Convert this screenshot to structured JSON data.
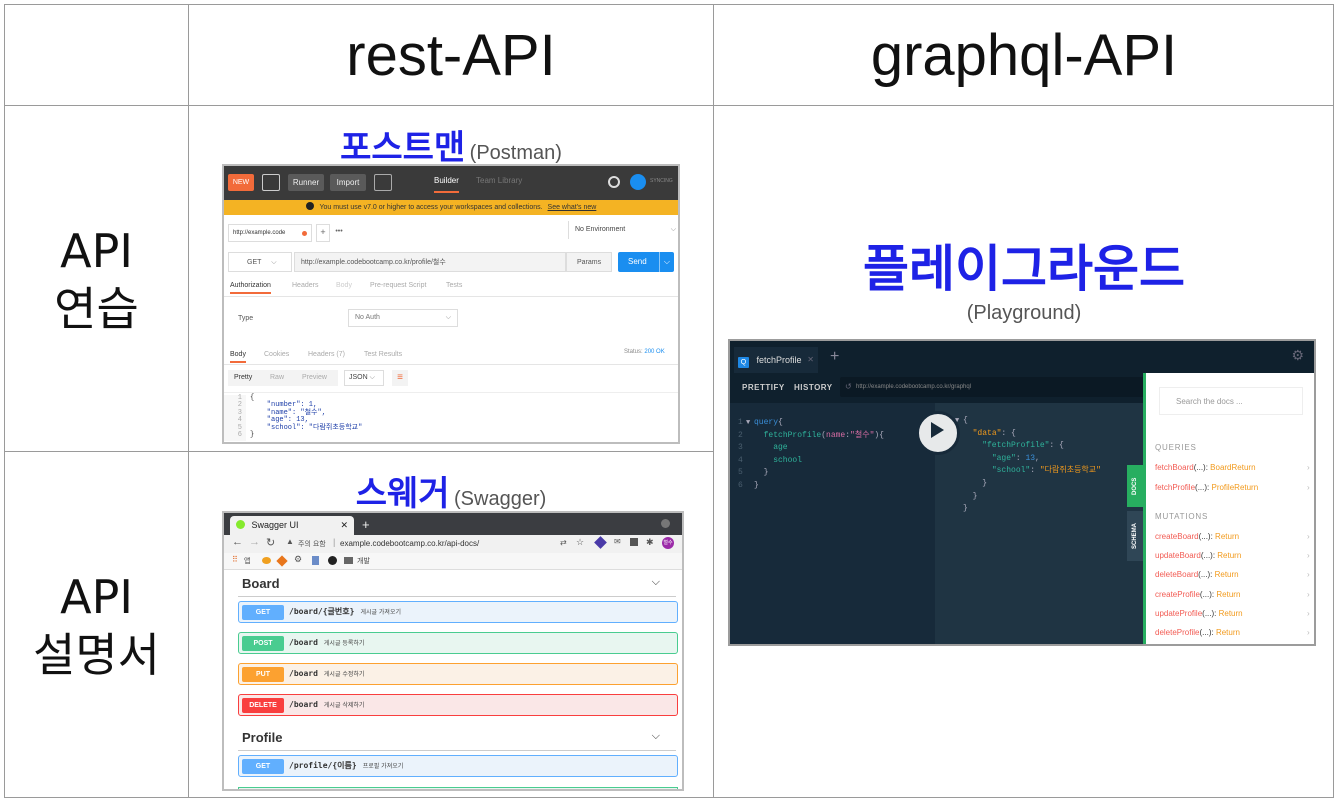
{
  "table": {
    "col_headers": [
      "rest-API",
      "graphql-API"
    ],
    "row_headers": [
      {
        "line1": "API",
        "line2": "연습"
      },
      {
        "line1": "API",
        "line2": "설명서"
      }
    ]
  },
  "tools": {
    "postman": {
      "kr": "포스트맨",
      "en": "(Postman)"
    },
    "swagger": {
      "kr": "스웨거",
      "en": "(Swagger)"
    },
    "playground": {
      "kr": "플레이그라운드",
      "en": "(Playground)"
    }
  },
  "postman": {
    "new_label": "NEW",
    "runner_label": "Runner",
    "import_label": "Import",
    "builder_tab": "Builder",
    "team_library_tab": "Team Library",
    "syncing": "SYNCING",
    "warning": "You must use v7.0 or higher to access your workspaces and collections.",
    "warning_link": "See what's new",
    "request_tab": "http://example.code",
    "environment": "No Environment",
    "method": "GET",
    "url": "http://example.codebootcamp.co.kr/profile/철수",
    "params_label": "Params",
    "send_label": "Send",
    "req_tabs": [
      "Authorization",
      "Headers",
      "Body",
      "Pre-request Script",
      "Tests"
    ],
    "type_label": "Type",
    "auth_value": "No Auth",
    "resp_tabs": [
      "Body",
      "Cookies",
      "Headers (7)",
      "Test Results"
    ],
    "status_label": "Status:",
    "status_value": "200 OK",
    "view_tabs": [
      "Pretty",
      "Raw",
      "Preview"
    ],
    "format": "JSON",
    "code_lines": [
      "{",
      "    \"number\": 1,",
      "    \"name\": \"철수\",",
      "    \"age\": 13,",
      "    \"school\": \"다람쥐초등학교\"",
      "}"
    ]
  },
  "swagger": {
    "tab_title": "Swagger UI",
    "address_warning": "주의 요함",
    "address": "example.codebootcamp.co.kr/api-docs/",
    "bookmarks": [
      "앱",
      "개발"
    ],
    "profile_badge": "철수",
    "sections": [
      {
        "title": "Board",
        "ops": [
          {
            "method": "GET",
            "path": "/board/{글번호}",
            "desc": "게시글 가져오기",
            "color": "#61affe",
            "bg": "#ebf3fb"
          },
          {
            "method": "POST",
            "path": "/board",
            "desc": "게시글 등록하기",
            "color": "#49cc90",
            "bg": "#e8f6f0"
          },
          {
            "method": "PUT",
            "path": "/board",
            "desc": "게시글 수정하기",
            "color": "#fca130",
            "bg": "#fbf1e6"
          },
          {
            "method": "DELETE",
            "path": "/board",
            "desc": "게시글 삭제하기",
            "color": "#f93e3e",
            "bg": "#fae7e7"
          }
        ]
      },
      {
        "title": "Profile",
        "ops": [
          {
            "method": "GET",
            "path": "/profile/{이름}",
            "desc": "프로필 가져오기",
            "color": "#61affe",
            "bg": "#ebf3fb"
          }
        ]
      }
    ]
  },
  "playground": {
    "tab_title": "fetchProfile",
    "prettify": "PRETTIFY",
    "history": "HISTORY",
    "url": "http://example.codebootcamp.co.kr/graphql",
    "docs_tab": "DOCS",
    "schema_tab": "SCHEMA",
    "search_placeholder": "Search the docs ...",
    "queries_heading": "QUERIES",
    "mutations_heading": "MUTATIONS",
    "queries": [
      {
        "name": "fetchBoard",
        "args": "(...): ",
        "ret": "BoardReturn"
      },
      {
        "name": "fetchProfile",
        "args": "(...): ",
        "ret": "ProfileReturn"
      }
    ],
    "mutations": [
      {
        "name": "createBoard",
        "args": "(...): ",
        "ret": "Return"
      },
      {
        "name": "updateBoard",
        "args": "(...): ",
        "ret": "Return"
      },
      {
        "name": "deleteBoard",
        "args": "(...): ",
        "ret": "Return"
      },
      {
        "name": "createProfile",
        "args": "(...): ",
        "ret": "Return"
      },
      {
        "name": "updateProfile",
        "args": "(...): ",
        "ret": "Return"
      },
      {
        "name": "deleteProfile",
        "args": "(...): ",
        "ret": "Return"
      }
    ],
    "query_text": {
      "kw": "query",
      "field": "fetchProfile",
      "arg": "name",
      "val": "\"철수\"",
      "f1": "age",
      "f2": "school"
    },
    "result": {
      "data_key": "\"data\"",
      "profile_key": "\"fetchProfile\"",
      "age_key": "\"age\"",
      "age_val": "13",
      "school_key": "\"school\"",
      "school_val": "\"다람쥐초등학교\""
    }
  }
}
